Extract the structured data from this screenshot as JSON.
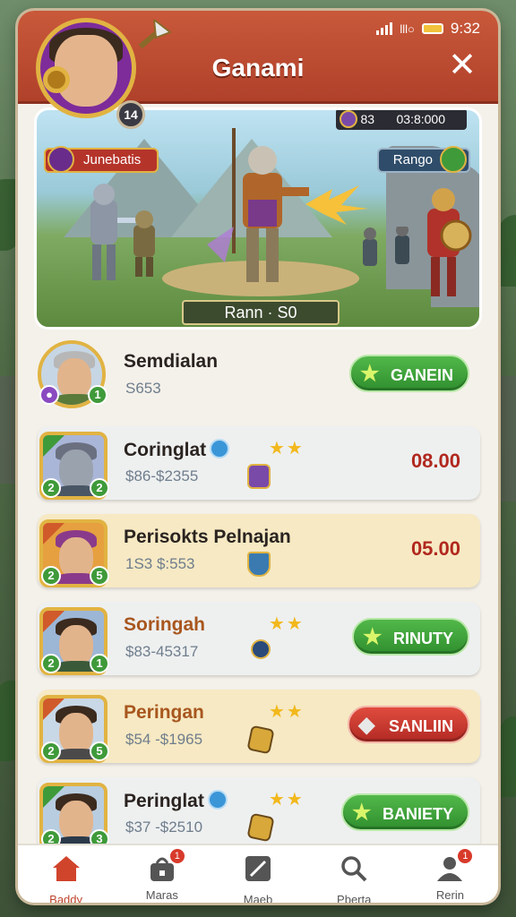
{
  "status_bar": {
    "signal_label": "lll○",
    "time": "9:32"
  },
  "header": {
    "title": "Ganami",
    "close_glyph": "✕",
    "level": "14"
  },
  "battle": {
    "left_banner": "Junebatis",
    "right_banner": "Rango",
    "score": "03:8:000",
    "score_prefix": "83",
    "rank_plate": "Rann · S0"
  },
  "players": [
    {
      "name": "Semdialan",
      "sub": "S653",
      "stars": 0,
      "action": {
        "type": "button",
        "label": "GANEIN",
        "style": "green",
        "icon": "star-icon"
      },
      "badges": [
        "1"
      ],
      "row_style": "first"
    },
    {
      "name": "Coringlat",
      "sub": "$86-$2355",
      "stars": 2,
      "verified": true,
      "action": {
        "type": "price",
        "label": "08.00"
      },
      "badges": [
        "2",
        "2"
      ],
      "row_style": "alt"
    },
    {
      "name": "Perisokts Pelnajan",
      "sub": "1S3 $:553",
      "stars": 0,
      "action": {
        "type": "price",
        "label": "05.00"
      },
      "badges": [
        "2",
        "5"
      ],
      "row_style": "gold"
    },
    {
      "name": "Soringah",
      "sub": "$83-45317",
      "stars": 2,
      "action": {
        "type": "button",
        "label": "RINUTY",
        "style": "green",
        "icon": "star-icon"
      },
      "badges": [
        "2",
        "1"
      ],
      "row_style": "alt",
      "name_color": "orange"
    },
    {
      "name": "Peringan",
      "sub": "$54 -$1965",
      "stars": 2,
      "action": {
        "type": "button",
        "label": "SANLIIN",
        "style": "red",
        "icon": "gem-icon"
      },
      "badges": [
        "2",
        "5"
      ],
      "row_style": "gold",
      "name_color": "orange"
    },
    {
      "name": "Peringlat",
      "sub": "$37 -$2510",
      "stars": 2,
      "verified": true,
      "action": {
        "type": "button",
        "label": "BANIETY",
        "style": "green",
        "icon": "star-icon"
      },
      "badges": [
        "2",
        "3"
      ],
      "row_style": "alt"
    }
  ],
  "tabs": [
    {
      "label": "Baddy",
      "icon": "home-icon",
      "active": true,
      "notif": ""
    },
    {
      "label": "Maras",
      "icon": "bag-icon",
      "active": false,
      "notif": "1"
    },
    {
      "label": "Maeb",
      "icon": "edit-icon",
      "active": false,
      "notif": ""
    },
    {
      "label": "Pberta",
      "icon": "search-icon",
      "active": false,
      "notif": ""
    },
    {
      "label": "Rerin",
      "icon": "profile-icon",
      "active": false,
      "notif": "1"
    }
  ],
  "colors": {
    "header": "#c9593a",
    "accent_gold": "#e1b342",
    "price_red": "#b1281e",
    "green_button": "#3f9a3a",
    "red_button": "#c8342a"
  }
}
